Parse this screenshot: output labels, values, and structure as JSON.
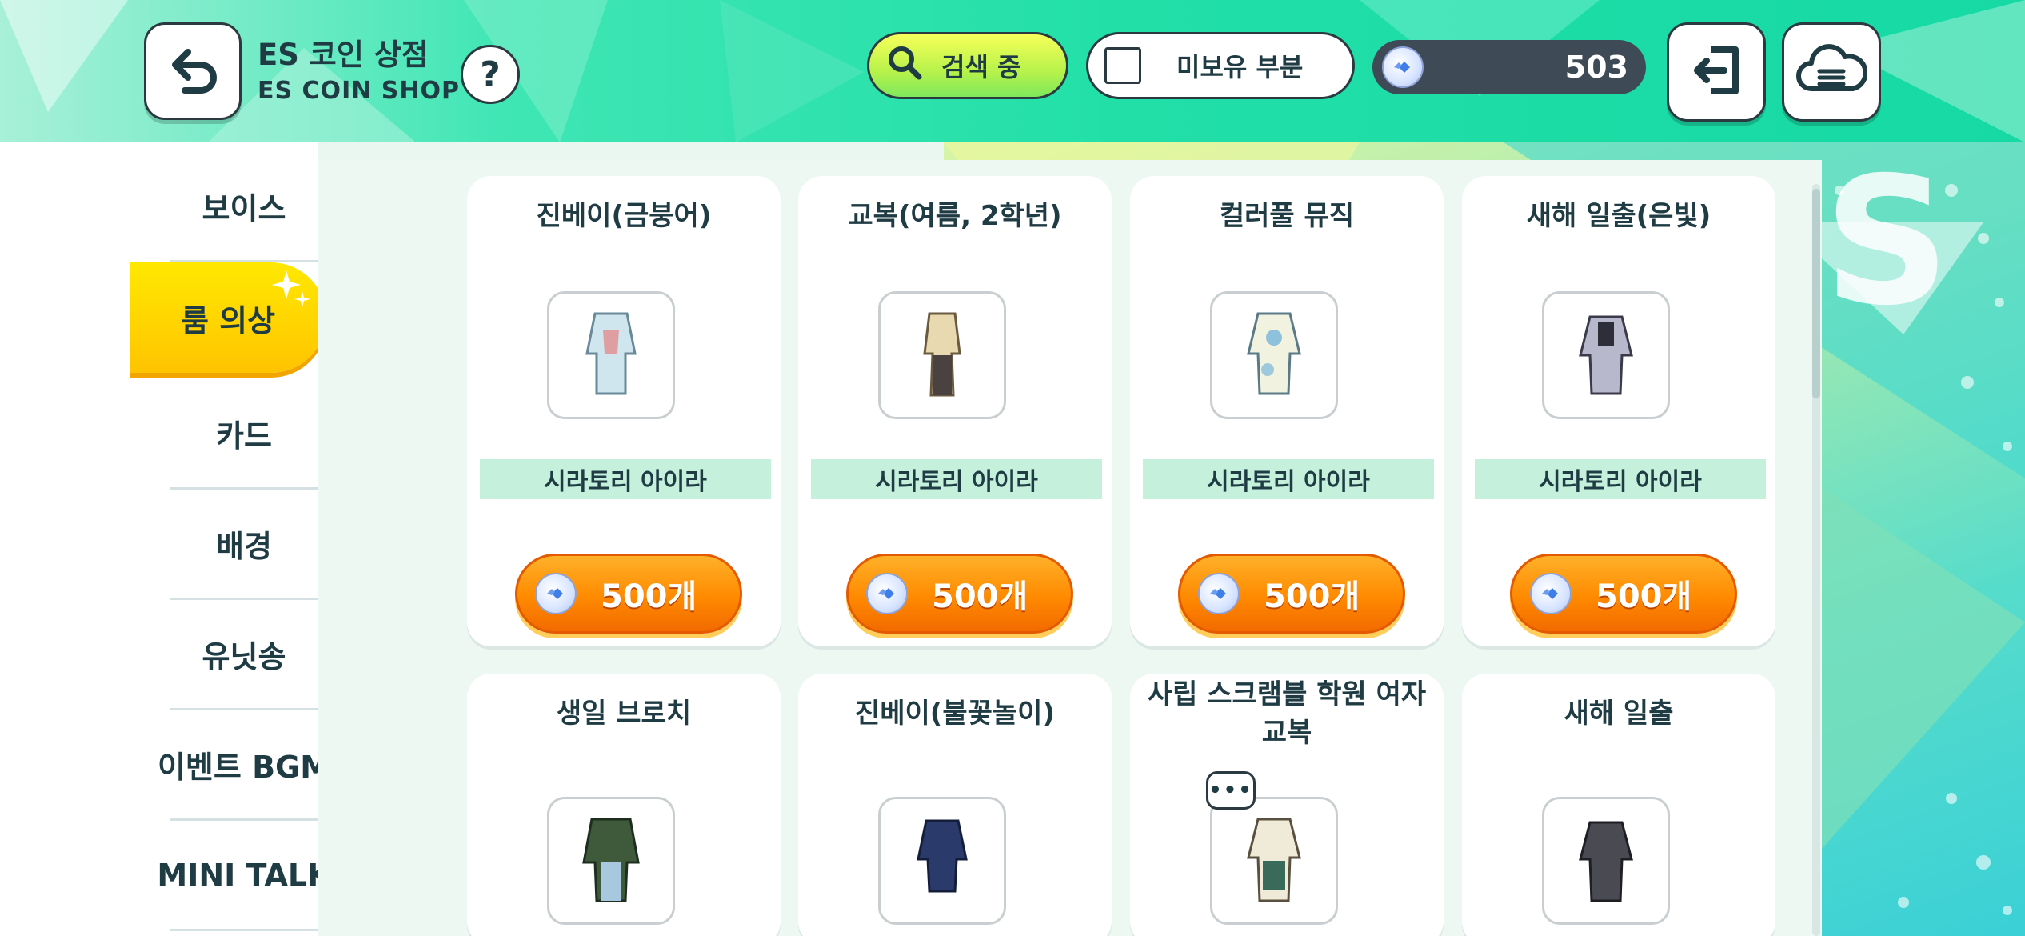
{
  "header": {
    "title_ko": "ES 코인 상점",
    "title_en": "ES COIN SHOP",
    "help_label": "?",
    "search_label": "검색 중",
    "filter_label": "미보유 부분",
    "coin_balance": "503"
  },
  "sidebar": {
    "items": [
      {
        "label": "보이스",
        "active": false
      },
      {
        "label": "룸 의상",
        "active": true
      },
      {
        "label": "카드",
        "active": false
      },
      {
        "label": "배경",
        "active": false
      },
      {
        "label": "유닛송",
        "active": false
      },
      {
        "label": "이벤트 BGM",
        "active": false
      },
      {
        "label": "MINI TALK",
        "active": false
      }
    ]
  },
  "items": [
    {
      "name": "진베이(금붕어)",
      "character": "시라토리 아이라",
      "price": "500개"
    },
    {
      "name": "교복(여름, 2학년)",
      "character": "시라토리 아이라",
      "price": "500개"
    },
    {
      "name": "컬러풀 뮤직",
      "character": "시라토리 아이라",
      "price": "500개"
    },
    {
      "name": "새해 일출(은빛)",
      "character": "시라토리 아이라",
      "price": "500개"
    },
    {
      "name": "생일 브로치"
    },
    {
      "name": "진베이(불꽃놀이)"
    },
    {
      "name": "사립 스크램블 학원 여자 교복"
    },
    {
      "name": "새해 일출"
    }
  ],
  "bubble_label": "•••",
  "colors": {
    "accent": "#ff8a00",
    "active_tab": "#ffd800",
    "header": "#22dfa8"
  }
}
